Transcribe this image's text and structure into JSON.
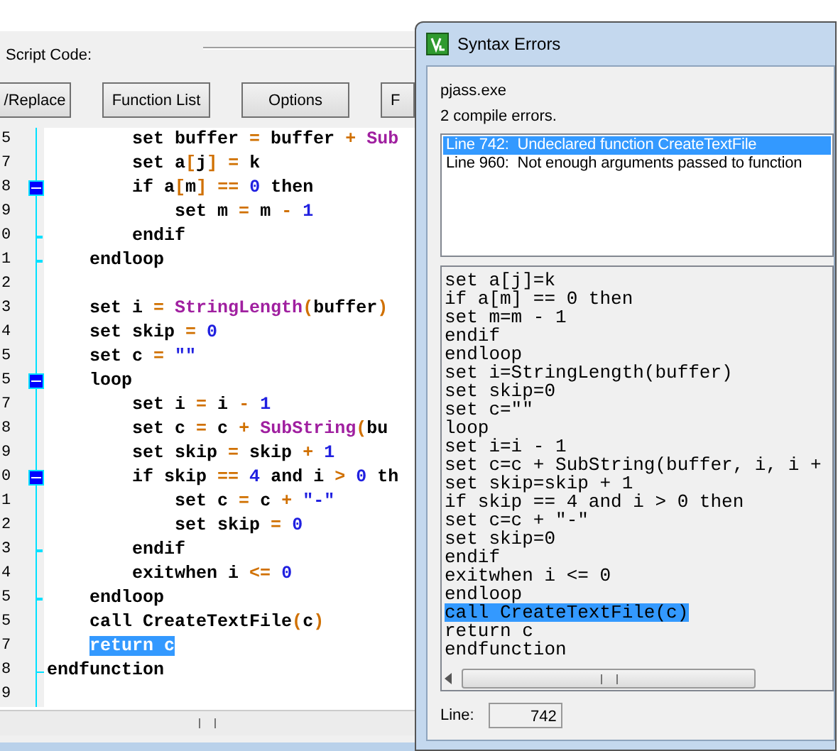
{
  "main_window": {
    "group_label": "Script Code:",
    "buttons": [
      "/Replace",
      "Function List",
      "Options",
      "F"
    ],
    "editor": {
      "lines": [
        {
          "number": "5",
          "kind": "plain",
          "tokens": [
            {
              "kind": "k",
              "text": "        set "
            },
            {
              "kind": "i",
              "text": "buffer "
            },
            {
              "kind": "o",
              "text": "= "
            },
            {
              "kind": "i",
              "text": "buffer "
            },
            {
              "kind": "o",
              "text": "+ "
            },
            {
              "kind": "f",
              "text": "Sub"
            }
          ]
        },
        {
          "number": "7",
          "kind": "plain",
          "tokens": [
            {
              "kind": "k",
              "text": "        set "
            },
            {
              "kind": "i",
              "text": "a"
            },
            {
              "kind": "o",
              "text": "["
            },
            {
              "kind": "i",
              "text": "j"
            },
            {
              "kind": "o",
              "text": "] = "
            },
            {
              "kind": "i",
              "text": "k"
            }
          ]
        },
        {
          "number": "8",
          "kind": "foldstart",
          "tokens": [
            {
              "kind": "k",
              "text": "        if "
            },
            {
              "kind": "i",
              "text": "a"
            },
            {
              "kind": "o",
              "text": "["
            },
            {
              "kind": "i",
              "text": "m"
            },
            {
              "kind": "o",
              "text": "] == "
            },
            {
              "kind": "n",
              "text": "0 "
            },
            {
              "kind": "k",
              "text": "then"
            }
          ]
        },
        {
          "number": "9",
          "kind": "plain",
          "tokens": [
            {
              "kind": "k",
              "text": "            set "
            },
            {
              "kind": "i",
              "text": "m "
            },
            {
              "kind": "o",
              "text": "= "
            },
            {
              "kind": "i",
              "text": "m "
            },
            {
              "kind": "o",
              "text": "- "
            },
            {
              "kind": "n",
              "text": "1"
            }
          ]
        },
        {
          "number": "0",
          "kind": "foldend",
          "tokens": [
            {
              "kind": "k",
              "text": "        endif"
            }
          ]
        },
        {
          "number": "1",
          "kind": "foldend",
          "tokens": [
            {
              "kind": "k",
              "text": "    endloop"
            }
          ]
        },
        {
          "number": "2",
          "kind": "plain"
        },
        {
          "number": "3",
          "kind": "plain",
          "tokens": [
            {
              "kind": "k",
              "text": "    set "
            },
            {
              "kind": "i",
              "text": "i "
            },
            {
              "kind": "o",
              "text": "= "
            },
            {
              "kind": "f",
              "text": "StringLength"
            },
            {
              "kind": "o",
              "text": "("
            },
            {
              "kind": "i",
              "text": "buffer"
            },
            {
              "kind": "o",
              "text": ")"
            }
          ]
        },
        {
          "number": "4",
          "kind": "plain",
          "tokens": [
            {
              "kind": "k",
              "text": "    set "
            },
            {
              "kind": "i",
              "text": "skip "
            },
            {
              "kind": "o",
              "text": "= "
            },
            {
              "kind": "n",
              "text": "0"
            }
          ]
        },
        {
          "number": "5",
          "kind": "plain",
          "tokens": [
            {
              "kind": "k",
              "text": "    set "
            },
            {
              "kind": "i",
              "text": "c "
            },
            {
              "kind": "o",
              "text": "= "
            },
            {
              "kind": "s",
              "text": "\"\""
            }
          ]
        },
        {
          "number": "5",
          "kind": "foldstart",
          "tokens": [
            {
              "kind": "k",
              "text": "    loop"
            }
          ]
        },
        {
          "number": "7",
          "kind": "plain",
          "tokens": [
            {
              "kind": "k",
              "text": "        set "
            },
            {
              "kind": "i",
              "text": "i "
            },
            {
              "kind": "o",
              "text": "= "
            },
            {
              "kind": "i",
              "text": "i "
            },
            {
              "kind": "o",
              "text": "- "
            },
            {
              "kind": "n",
              "text": "1"
            }
          ]
        },
        {
          "number": "8",
          "kind": "plain",
          "tokens": [
            {
              "kind": "k",
              "text": "        set "
            },
            {
              "kind": "i",
              "text": "c "
            },
            {
              "kind": "o",
              "text": "= "
            },
            {
              "kind": "i",
              "text": "c "
            },
            {
              "kind": "o",
              "text": "+ "
            },
            {
              "kind": "f",
              "text": "SubString"
            },
            {
              "kind": "o",
              "text": "("
            },
            {
              "kind": "i",
              "text": "bu"
            }
          ]
        },
        {
          "number": "9",
          "kind": "plain",
          "tokens": [
            {
              "kind": "k",
              "text": "        set "
            },
            {
              "kind": "i",
              "text": "skip "
            },
            {
              "kind": "o",
              "text": "= "
            },
            {
              "kind": "i",
              "text": "skip "
            },
            {
              "kind": "o",
              "text": "+ "
            },
            {
              "kind": "n",
              "text": "1"
            }
          ]
        },
        {
          "number": "0",
          "kind": "foldstart",
          "tokens": [
            {
              "kind": "k",
              "text": "        if "
            },
            {
              "kind": "i",
              "text": "skip "
            },
            {
              "kind": "o",
              "text": "== "
            },
            {
              "kind": "n",
              "text": "4 "
            },
            {
              "kind": "k",
              "text": "and "
            },
            {
              "kind": "i",
              "text": "i "
            },
            {
              "kind": "o",
              "text": "> "
            },
            {
              "kind": "n",
              "text": "0 "
            },
            {
              "kind": "k",
              "text": "th"
            }
          ]
        },
        {
          "number": "1",
          "kind": "plain",
          "tokens": [
            {
              "kind": "k",
              "text": "            set "
            },
            {
              "kind": "i",
              "text": "c "
            },
            {
              "kind": "o",
              "text": "= "
            },
            {
              "kind": "i",
              "text": "c "
            },
            {
              "kind": "o",
              "text": "+ "
            },
            {
              "kind": "s",
              "text": "\"-\""
            }
          ]
        },
        {
          "number": "2",
          "kind": "plain",
          "tokens": [
            {
              "kind": "k",
              "text": "            set "
            },
            {
              "kind": "i",
              "text": "skip "
            },
            {
              "kind": "o",
              "text": "= "
            },
            {
              "kind": "n",
              "text": "0"
            }
          ]
        },
        {
          "number": "3",
          "kind": "foldend",
          "tokens": [
            {
              "kind": "k",
              "text": "        endif"
            }
          ]
        },
        {
          "number": "4",
          "kind": "plain",
          "tokens": [
            {
              "kind": "k",
              "text": "        exitwhen "
            },
            {
              "kind": "i",
              "text": "i "
            },
            {
              "kind": "o",
              "text": "<= "
            },
            {
              "kind": "n",
              "text": "0"
            }
          ]
        },
        {
          "number": "5",
          "kind": "foldend",
          "tokens": [
            {
              "kind": "k",
              "text": "    endloop"
            }
          ]
        },
        {
          "number": "5",
          "kind": "plain",
          "tokens": [
            {
              "kind": "k",
              "text": "    call "
            },
            {
              "kind": "i",
              "text": "CreateTextFile"
            },
            {
              "kind": "o",
              "text": "("
            },
            {
              "kind": "i",
              "text": "c"
            },
            {
              "kind": "o",
              "text": ")"
            }
          ]
        },
        {
          "number": "7",
          "kind": "plain",
          "tokens": [
            {
              "kind": "sel",
              "text": "    return c"
            }
          ]
        },
        {
          "number": "8",
          "kind": "foldlast",
          "tokens": [
            {
              "kind": "k",
              "text": "endfunction"
            }
          ]
        },
        {
          "number": "9",
          "kind": "plain"
        }
      ]
    }
  },
  "dialog": {
    "title": "Syntax Errors",
    "program": "pjass.exe",
    "summary": "2 compile errors.",
    "errors": [
      {
        "text": "Line 742:  Undeclared function CreateTextFile",
        "selected": true
      },
      {
        "text": "Line 960:  Not enough arguments passed to function",
        "selected": false
      }
    ],
    "source_lines": [
      {
        "text": "set a[j]=k",
        "selected": false
      },
      {
        "text": "if a[m] == 0 then",
        "selected": false
      },
      {
        "text": "set m=m - 1",
        "selected": false
      },
      {
        "text": "endif",
        "selected": false
      },
      {
        "text": "endloop",
        "selected": false
      },
      {
        "text": "set i=StringLength(buffer)",
        "selected": false
      },
      {
        "text": "set skip=0",
        "selected": false
      },
      {
        "text": "set c=\"\"",
        "selected": false
      },
      {
        "text": "loop",
        "selected": false
      },
      {
        "text": "set i=i - 1",
        "selected": false
      },
      {
        "text": "set c=c + SubString(buffer, i, i +",
        "selected": false
      },
      {
        "text": "set skip=skip + 1",
        "selected": false
      },
      {
        "text": "if skip == 4 and i > 0 then",
        "selected": false
      },
      {
        "text": "set c=c + \"-\"",
        "selected": false
      },
      {
        "text": "set skip=0",
        "selected": false
      },
      {
        "text": "endif",
        "selected": false
      },
      {
        "text": "exitwhen i <= 0",
        "selected": false
      },
      {
        "text": "endloop",
        "selected": false
      },
      {
        "text": "call CreateTextFile(c)",
        "selected": true
      },
      {
        "text": "return c",
        "selected": false
      },
      {
        "text": "endfunction",
        "selected": false
      }
    ],
    "line_label": "Line:",
    "line_value": "742"
  }
}
